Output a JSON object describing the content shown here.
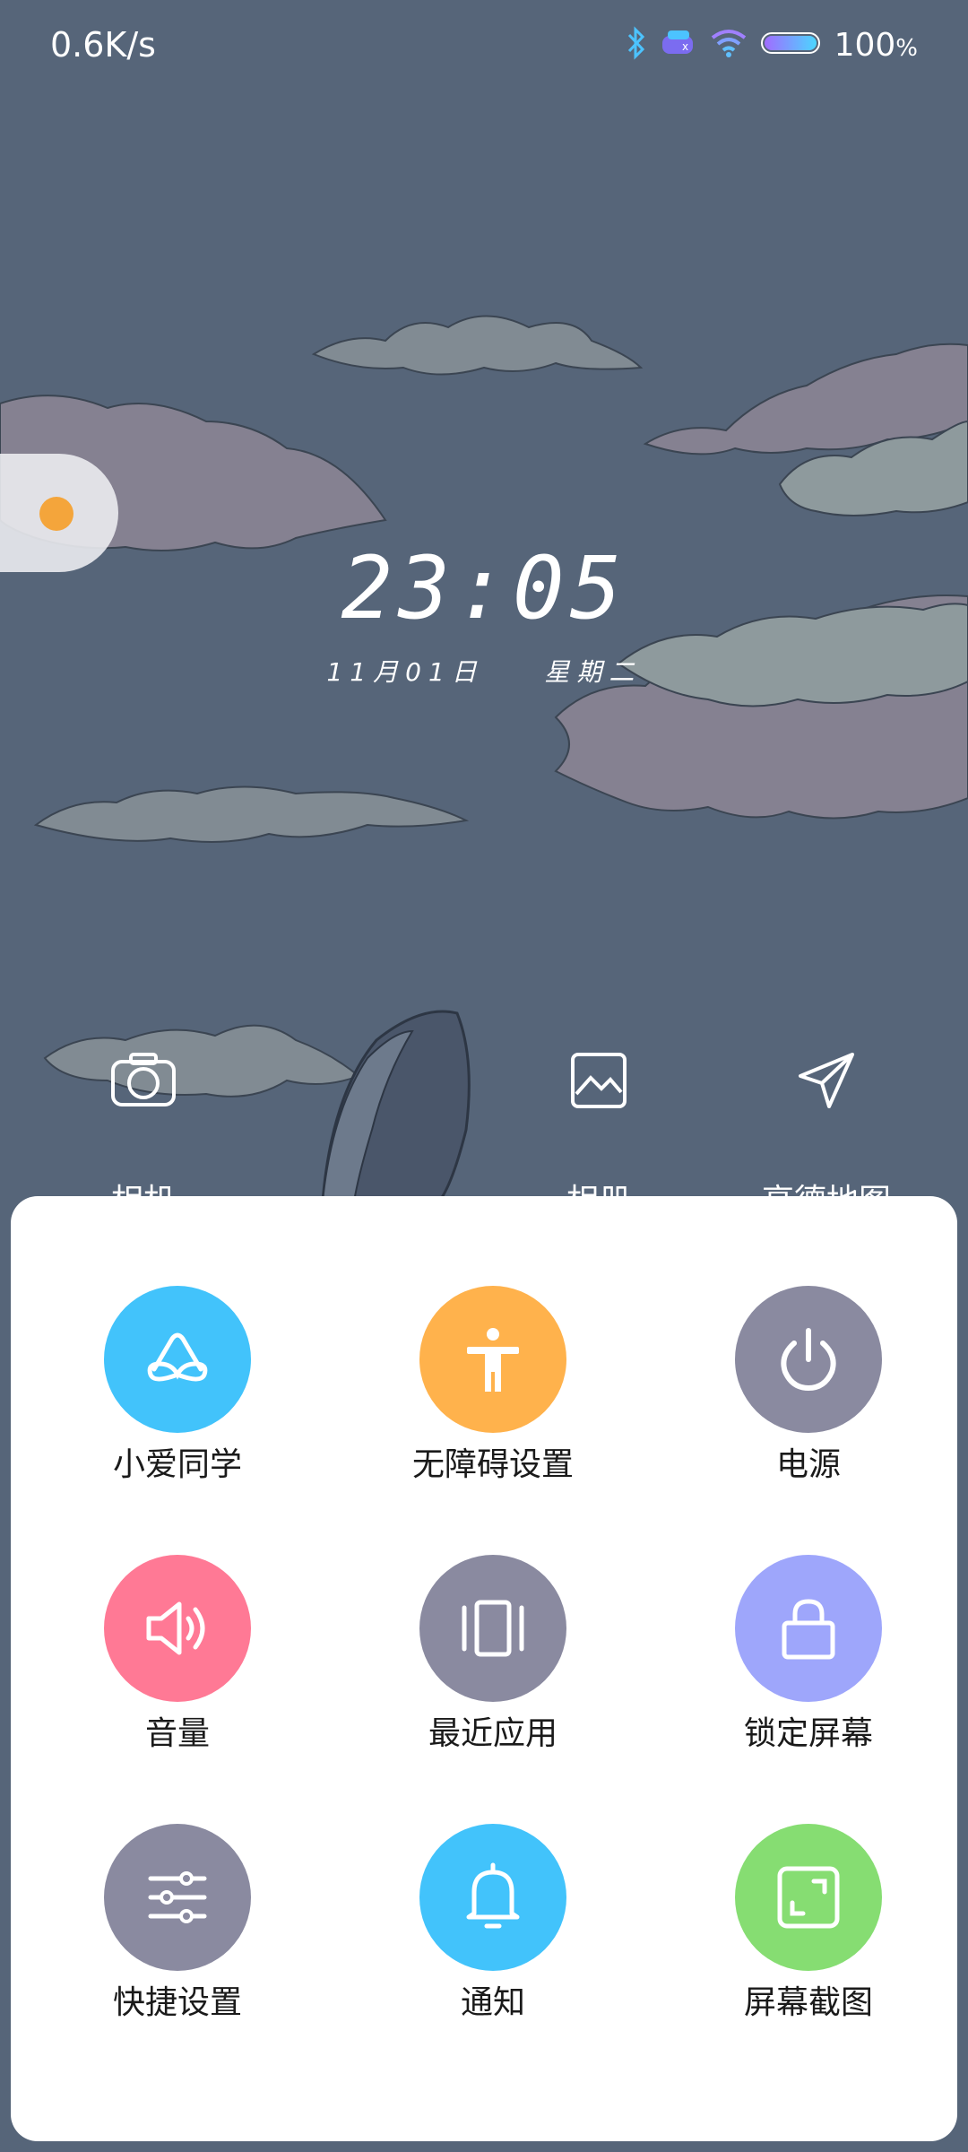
{
  "status_bar": {
    "net_speed": "0.6K/s",
    "battery_percent": "100",
    "battery_percent_unit": "%",
    "icons": [
      "bluetooth-icon",
      "vpn-icon",
      "wifi-icon",
      "battery-icon"
    ]
  },
  "lock_screen": {
    "time": "23:05",
    "date": "11月01日",
    "weekday": "星期二"
  },
  "shortcuts": [
    {
      "label": "相机",
      "icon": "camera-icon"
    },
    {
      "label": "相册",
      "icon": "gallery-icon"
    },
    {
      "label": "高德地图",
      "icon": "navigation-icon"
    }
  ],
  "panel": {
    "items": [
      {
        "label": "小爱同学",
        "icon": "xiaoai-icon",
        "color": "#42c3fb"
      },
      {
        "label": "无障碍设置",
        "icon": "accessibility-icon",
        "color": "#ffb24c"
      },
      {
        "label": "电源",
        "icon": "power-icon",
        "color": "#8a8aa0"
      },
      {
        "label": "音量",
        "icon": "volume-icon",
        "color": "#ff7995"
      },
      {
        "label": "最近应用",
        "icon": "recent-apps-icon",
        "color": "#8a8aa0"
      },
      {
        "label": "锁定屏幕",
        "icon": "lock-icon",
        "color": "#9ea6fb"
      },
      {
        "label": "快捷设置",
        "icon": "sliders-icon",
        "color": "#8a8aa0"
      },
      {
        "label": "通知",
        "icon": "bell-icon",
        "color": "#42c3fb"
      },
      {
        "label": "屏幕截图",
        "icon": "screenshot-icon",
        "color": "#86dd72"
      }
    ]
  }
}
